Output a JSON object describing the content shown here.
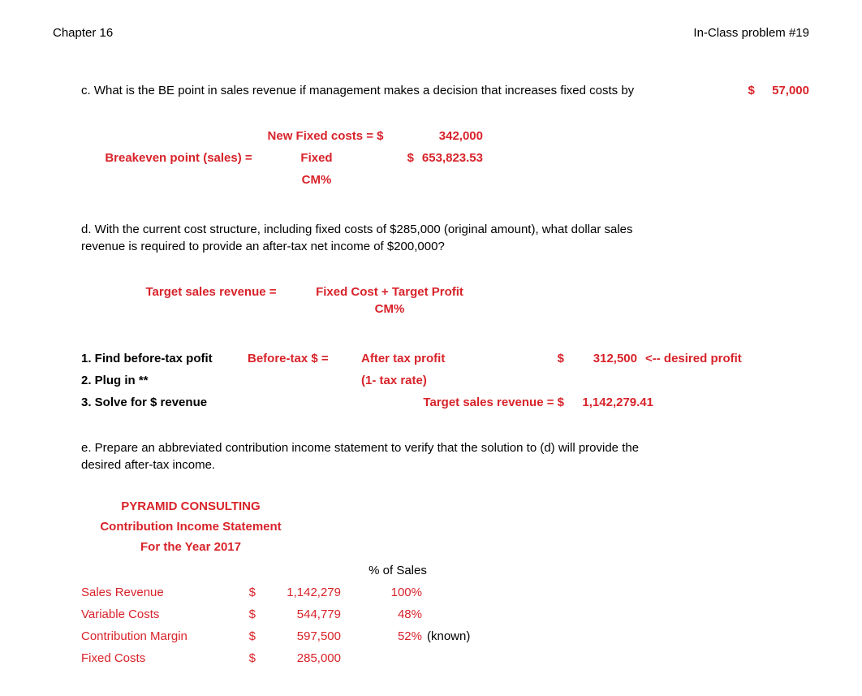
{
  "header": {
    "chapter": "Chapter 16",
    "title": "In-Class problem #19"
  },
  "c": {
    "question": "c. What is the BE point in sales revenue if management makes a decision that increases fixed costs by",
    "dollar": "$",
    "amount": "57,000",
    "newFixedLabel": "New Fixed costs =",
    "newFixedDollar": "$",
    "newFixedAmount": "342,000",
    "beLabel": "Breakeven point (sales) =",
    "fixedLabel": "Fixed",
    "fixedDollar": "$",
    "fixedAmount": "653,823.53",
    "cmLabel": "CM%"
  },
  "d": {
    "question": "d. With the current cost structure, including fixed costs of $285,000 (original amount), what dollar sales revenue is required to provide an after-tax net income of $200,000?",
    "tsrLabel": "Target sales revenue =",
    "tsrNum": "Fixed Cost + Target Profit",
    "tsrDen": "CM%",
    "step1": "1. Find before-tax pofit",
    "step1Mid": "Before-tax $ =",
    "step1Desc": "After tax profit",
    "step1Dollar": "$",
    "step1Amount": "312,500",
    "step1Note": "<-- desired profit",
    "step2": "2. Plug in **",
    "step2Desc": "(1- tax rate)",
    "step3": "3. Solve for $ revenue",
    "step3Label": "Target sales revenue = $",
    "step3Amount": "1,142,279.41"
  },
  "e": {
    "question": "e. Prepare an abbreviated contribution income statement to verify that the solution to (d) will provide the desired after-tax income.",
    "company": "PYRAMID CONSULTING",
    "stmtTitle": "Contribution Income Statement",
    "period": "For the Year 2017",
    "pctHeader": "% of Sales",
    "rows": {
      "salesLabel": "Sales Revenue",
      "salesDol": "$",
      "salesAmt": "1,142,279",
      "salesPct": "100%",
      "vcLabel": "Variable Costs",
      "vcDol": "$",
      "vcAmt": "544,779",
      "vcPct": "48%",
      "cmLabel": "Contribution Margin",
      "cmDol": "$",
      "cmAmt": "597,500",
      "cmPct": "52%",
      "cmKnown": "(known)",
      "fcLabel": "Fixed Costs",
      "fcDol": "$",
      "fcAmt": "285,000"
    }
  }
}
